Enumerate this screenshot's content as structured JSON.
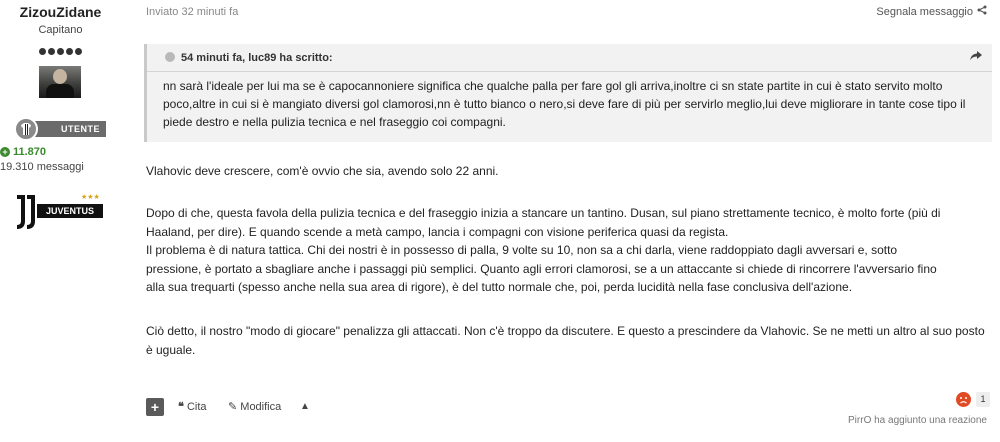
{
  "author": {
    "name": "ZizouZidane",
    "rank": "Capitano",
    "role": "UTENTE",
    "reputation": "11.870",
    "messages": "19.310 messaggi",
    "club_badge": "JUVENTUS",
    "club_stars": "★★★"
  },
  "post": {
    "meta": "Inviato 32 minuti fa",
    "report_label": "Segnala messaggio",
    "quote": {
      "header": "54 minuti fa, luc89 ha scritto:",
      "body": "nn sarà l'ideale per lui ma se è capocannoniere significa che qualche palla per fare gol gli arriva,inoltre ci sn state partite in cui è stato servito molto poco,altre in cui si è mangiato diversi gol clamorosi,nn è tutto bianco o nero,si deve fare di più per servirlo meglio,lui deve migliorare in tante cose tipo il piede destro e nella pulizia tecnica e nel fraseggio coi compagni."
    },
    "paragraphs": [
      "Vlahovic deve crescere, com'è ovvio che sia, avendo solo 22 anni.",
      "Dopo di che, questa favola della pulizia tecnica e del fraseggio inizia a stancare un tantino. Dusan, sul piano strettamente tecnico, è molto forte (più di Haaland, per dire). E quando scende a metà campo, lancia i compagni con visione periferica quasi da regista. Il problema è di natura tattica. Chi dei nostri è in possesso di palla, 9 volte su 10, non sa a chi darla, viene raddoppiato dagli avversari e, sotto pressione, è portato a sbagliare anche i passaggi più semplici. Quanto agli errori clamorosi, se a un attaccante si chiede di rincorrere l'avversario fino alla sua trequarti (spesso anche nella sua area di rigore), è del tutto normale che, poi, perda lucidità nella fase conclusiva dell'azione.",
      "Ciò detto, il nostro \"modo di giocare\" penalizza gli attaccati. Non c'è troppo da discutere. E questo a prescindere da Vlahovic. Se ne metti un altro al suo posto è uguale."
    ],
    "paragraph2_lines": [
      "Dopo di che, questa favola della pulizia tecnica e del fraseggio inizia a stancare un tantino. Dusan, sul piano strettamente tecnico, è molto forte (più di",
      "Haaland, per dire). E quando scende a metà campo, lancia i compagni con visione periferica quasi da regista.",
      "Il problema è di natura tattica. Chi dei nostri è in possesso di palla, 9 volte su 10, non sa a chi darla, viene raddoppiato dagli avversari e, sotto",
      "pressione, è portato a sbagliare anche i passaggi più semplici. Quanto agli errori clamorosi, se a un attaccante si chiede di rincorrere l'avversario fino",
      "alla sua trequarti (spesso anche nella sua area di rigore), è del tutto normale che, poi, perda lucidità nella fase conclusiva dell'azione."
    ]
  },
  "actions": {
    "add": "+",
    "quote_label": "Cita",
    "edit_label": "Modifica",
    "up_label": "▲"
  },
  "reactions": {
    "count": "1",
    "text": "PirrO ha aggiunto una reazione"
  },
  "icons": {
    "share": "share-icon",
    "quote_icon": "quote-marks-icon",
    "edit_icon": "pencil-icon",
    "reaction": "angry-face-icon"
  }
}
